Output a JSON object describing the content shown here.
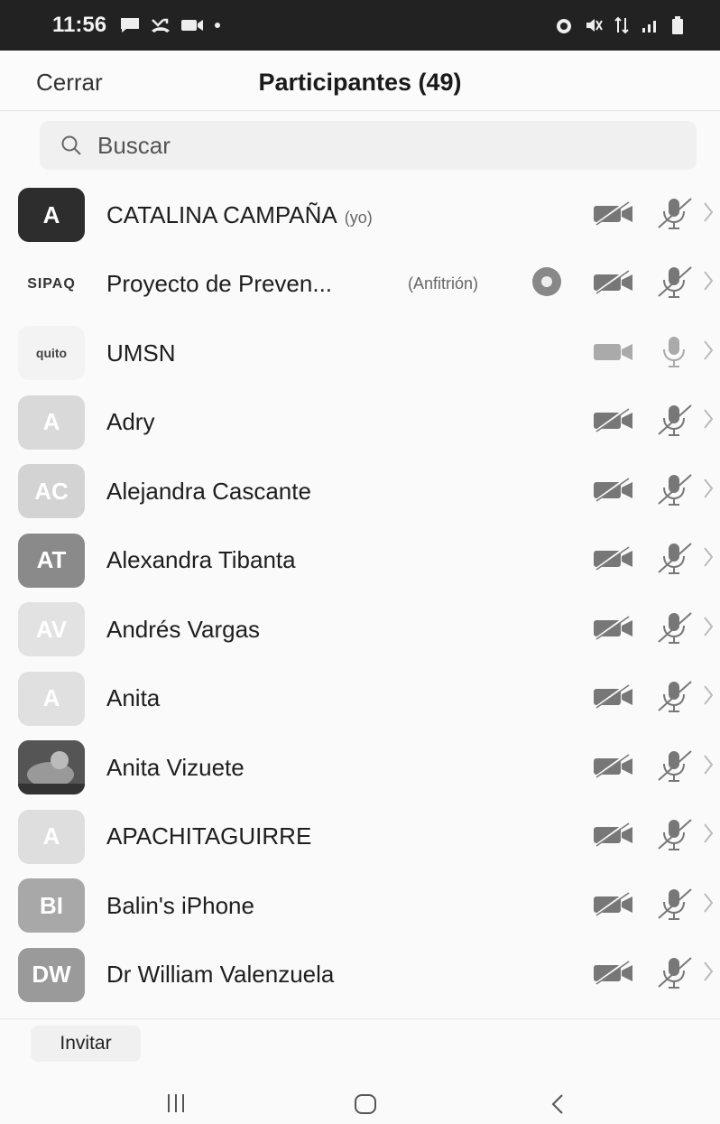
{
  "status_bar": {
    "time": "11:56",
    "left_icons": [
      "chat-icon",
      "missed-call-icon",
      "video-icon",
      "dot-icon"
    ],
    "right_icons": [
      "alarm-icon",
      "mute-icon",
      "data-icon",
      "signal-icon",
      "battery-icon"
    ]
  },
  "header": {
    "close_label": "Cerrar",
    "title": "Participantes (49)"
  },
  "search": {
    "placeholder": "Buscar"
  },
  "participants": [
    {
      "initials": "A",
      "name": "CATALINA CAMPAÑA",
      "tag": "(yo)",
      "avatar_color": "#2d2d2d",
      "video_muted": true,
      "mic_muted": true
    },
    {
      "initials": "SIPAQ",
      "name": "Proyecto de Preven...",
      "tag": "(Anfitrión)",
      "avatar_color": "transparent",
      "video_muted": true,
      "mic_muted": true,
      "sharing": true
    },
    {
      "initials": "quito",
      "name": "UMSN",
      "tag": "",
      "avatar_color": "#f3f3f3",
      "video_muted": false,
      "mic_muted": false
    },
    {
      "initials": "A",
      "name": "Adry",
      "tag": "",
      "avatar_color": "#d9d9d9",
      "video_muted": true,
      "mic_muted": true
    },
    {
      "initials": "AC",
      "name": "Alejandra Cascante",
      "tag": "",
      "avatar_color": "#d3d3d3",
      "video_muted": true,
      "mic_muted": true
    },
    {
      "initials": "AT",
      "name": "Alexandra Tibanta",
      "tag": "",
      "avatar_color": "#8a8a8a",
      "video_muted": true,
      "mic_muted": true
    },
    {
      "initials": "AV",
      "name": "Andrés Vargas",
      "tag": "",
      "avatar_color": "#e2e2e2",
      "video_muted": true,
      "mic_muted": true
    },
    {
      "initials": "A",
      "name": "Anita",
      "tag": "",
      "avatar_color": "#e0e0e0",
      "video_muted": true,
      "mic_muted": true
    },
    {
      "initials": "",
      "name": "Anita Vizuete",
      "tag": "",
      "avatar_color": "#6b6b6b",
      "video_muted": true,
      "mic_muted": true,
      "photo": true
    },
    {
      "initials": "A",
      "name": "APACHITAGUIRRE",
      "tag": "",
      "avatar_color": "#dedede",
      "video_muted": true,
      "mic_muted": true
    },
    {
      "initials": "BI",
      "name": "Balin's iPhone",
      "tag": "",
      "avatar_color": "#a8a8a8",
      "video_muted": true,
      "mic_muted": true
    },
    {
      "initials": "DW",
      "name": "Dr William Valenzuela",
      "tag": "",
      "avatar_color": "#9a9a9a",
      "video_muted": true,
      "mic_muted": true
    }
  ],
  "footer": {
    "invite_label": "Invitar"
  },
  "nav": [
    "recents-icon",
    "home-icon",
    "back-icon"
  ]
}
